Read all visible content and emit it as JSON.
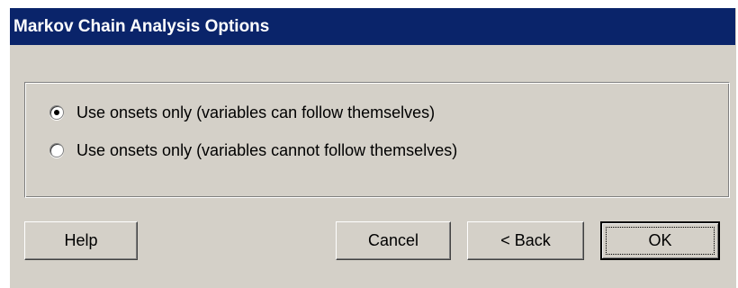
{
  "window": {
    "title": "Markov Chain Analysis Options"
  },
  "options": {
    "items": [
      {
        "label": "Use onsets only (variables can follow themselves)",
        "checked": true
      },
      {
        "label": "Use onsets only (variables cannot follow themselves)",
        "checked": false
      }
    ]
  },
  "buttons": {
    "help": "Help",
    "cancel": "Cancel",
    "back": "< Back",
    "ok": "OK"
  },
  "colors": {
    "titlebar": "#0a246a",
    "face": "#d4d0c8"
  }
}
